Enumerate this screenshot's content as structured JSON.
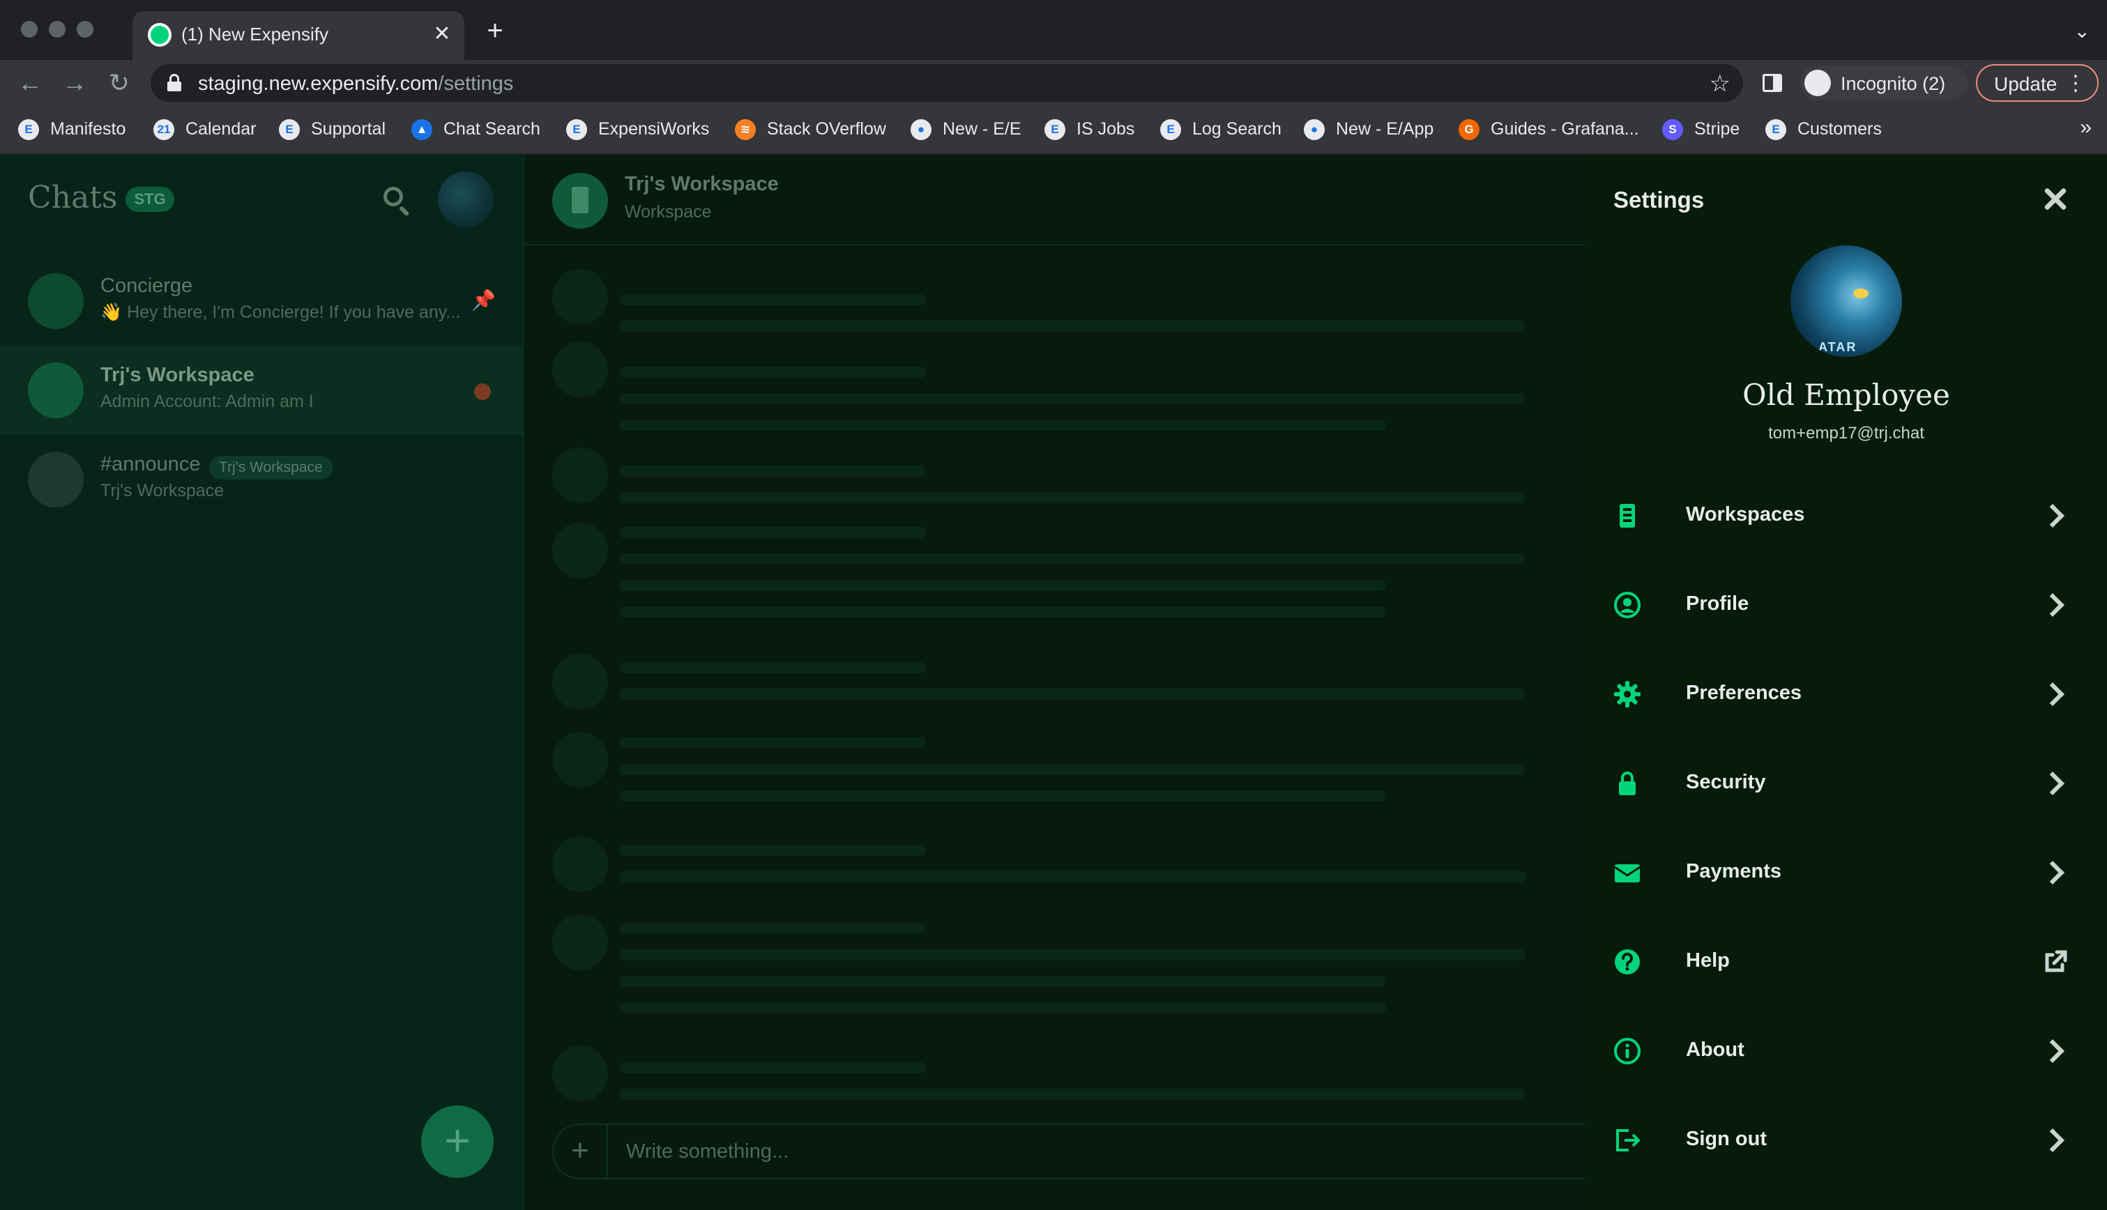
{
  "browser": {
    "tab_title": "(1) New Expensify",
    "tab_close": "✕",
    "new_tab": "+",
    "tab_menu": "⌄",
    "url_host": "staging.new.expensify.com",
    "url_path": "/settings",
    "incognito_label": "Incognito (2)",
    "update_label": "Update",
    "bookmarks": [
      {
        "label": "Manifesto",
        "icon": "E"
      },
      {
        "label": "Calendar",
        "icon": "21"
      },
      {
        "label": "Supportal",
        "icon": "E"
      },
      {
        "label": "Chat Search",
        "icon": "▲"
      },
      {
        "label": "ExpensiWorks",
        "icon": "E"
      },
      {
        "label": "Stack OVerflow",
        "icon": "≋"
      },
      {
        "label": "New - E/E",
        "icon": "●"
      },
      {
        "label": "IS Jobs",
        "icon": "E"
      },
      {
        "label": "Log Search",
        "icon": "E"
      },
      {
        "label": "New - E/App",
        "icon": "●"
      },
      {
        "label": "Guides - Grafana...",
        "icon": "G"
      },
      {
        "label": "Stripe",
        "icon": "S"
      },
      {
        "label": "Customers",
        "icon": "E"
      }
    ],
    "bookmarks_more": "»"
  },
  "lhn": {
    "title": "Chats",
    "env_badge": "STG",
    "chats": [
      {
        "name": "Concierge",
        "preview": "👋 Hey there, I'm Concierge! If you have any..."
      },
      {
        "name": "Trj's Workspace",
        "preview": "Admin Account: Admin am I"
      },
      {
        "name": "#announce",
        "tag": "Trj's Workspace",
        "preview": "Trj's Workspace"
      }
    ],
    "fab": "+"
  },
  "report": {
    "title": "Trj's Workspace",
    "subtitle": "Workspace",
    "composer_placeholder": "Write something..."
  },
  "settings": {
    "title": "Settings",
    "display_name": "Old Employee",
    "email": "tom+emp17@trj.chat",
    "avatar_text": "ATAR",
    "menu": [
      {
        "label": "Workspaces",
        "icon": "building-icon"
      },
      {
        "label": "Profile",
        "icon": "user-circle-icon"
      },
      {
        "label": "Preferences",
        "icon": "gear-icon"
      },
      {
        "label": "Security",
        "icon": "lock-icon"
      },
      {
        "label": "Payments",
        "icon": "wallet-icon"
      },
      {
        "label": "Help",
        "icon": "question-icon"
      },
      {
        "label": "About",
        "icon": "info-icon"
      },
      {
        "label": "Sign out",
        "icon": "sign-out-icon"
      }
    ],
    "accent_color": "#03d47c"
  }
}
